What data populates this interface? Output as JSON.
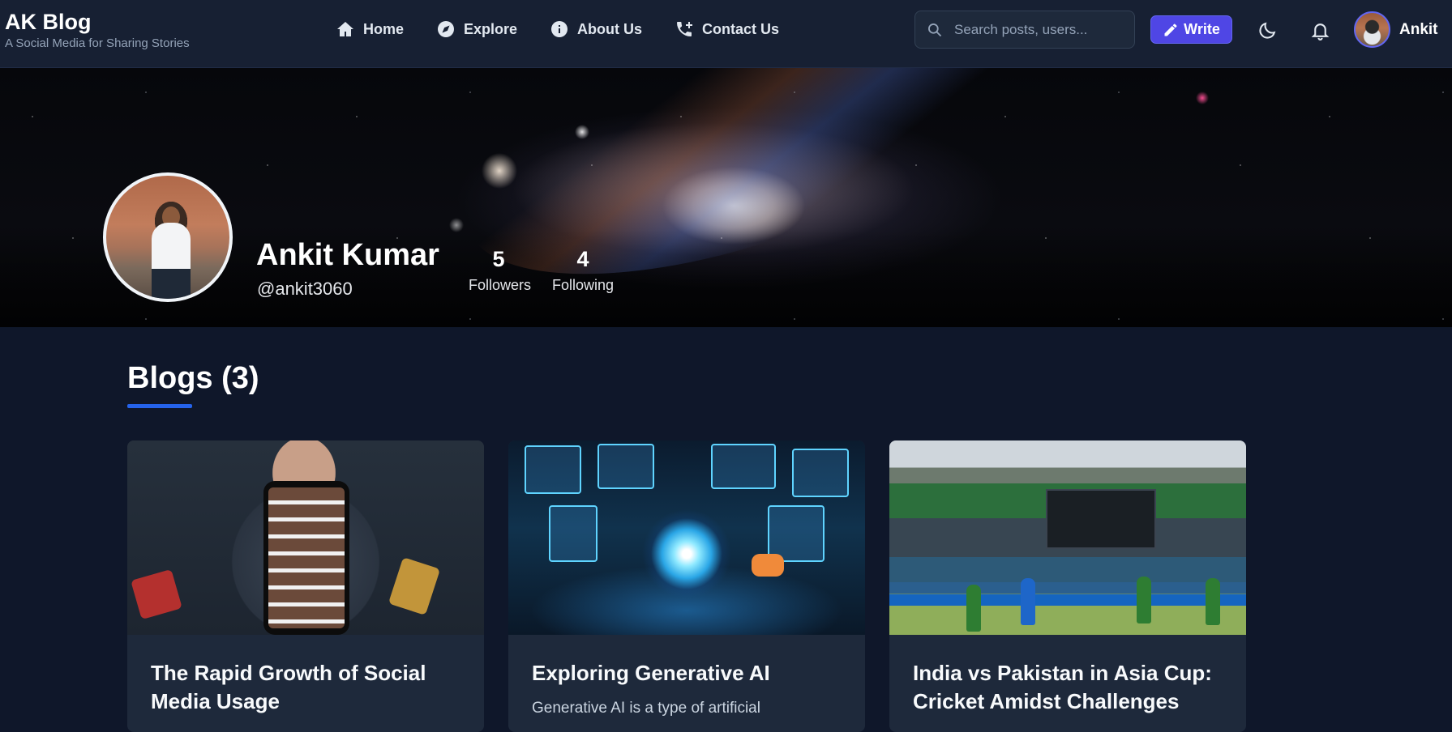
{
  "brand": {
    "title": "AK Blog",
    "tagline": "A Social Media for Sharing Stories"
  },
  "nav": {
    "items": [
      {
        "label": "Home",
        "icon": "home-icon"
      },
      {
        "label": "Explore",
        "icon": "compass-icon"
      },
      {
        "label": "About Us",
        "icon": "info-icon"
      },
      {
        "label": "Contact Us",
        "icon": "phone-plus-icon"
      }
    ]
  },
  "search": {
    "placeholder": "Search posts, users...",
    "value": ""
  },
  "toolbar": {
    "write_label": "Write",
    "user_name": "Ankit",
    "accent": "#4f46e5"
  },
  "profile": {
    "name": "Ankit Kumar",
    "handle": "@ankit3060",
    "followers_count": "5",
    "followers_label": "Followers",
    "following_count": "4",
    "following_label": "Following"
  },
  "blogs": {
    "heading": "Blogs (3)",
    "underline_color": "#2563eb",
    "cards": [
      {
        "title": "The Rapid Growth of Social Media Usage",
        "excerpt": ""
      },
      {
        "title": "Exploring Generative AI",
        "excerpt": "Generative AI is a type of artificial"
      },
      {
        "title": "India vs Pakistan in Asia Cup: Cricket Amidst Challenges",
        "excerpt": ""
      }
    ]
  }
}
